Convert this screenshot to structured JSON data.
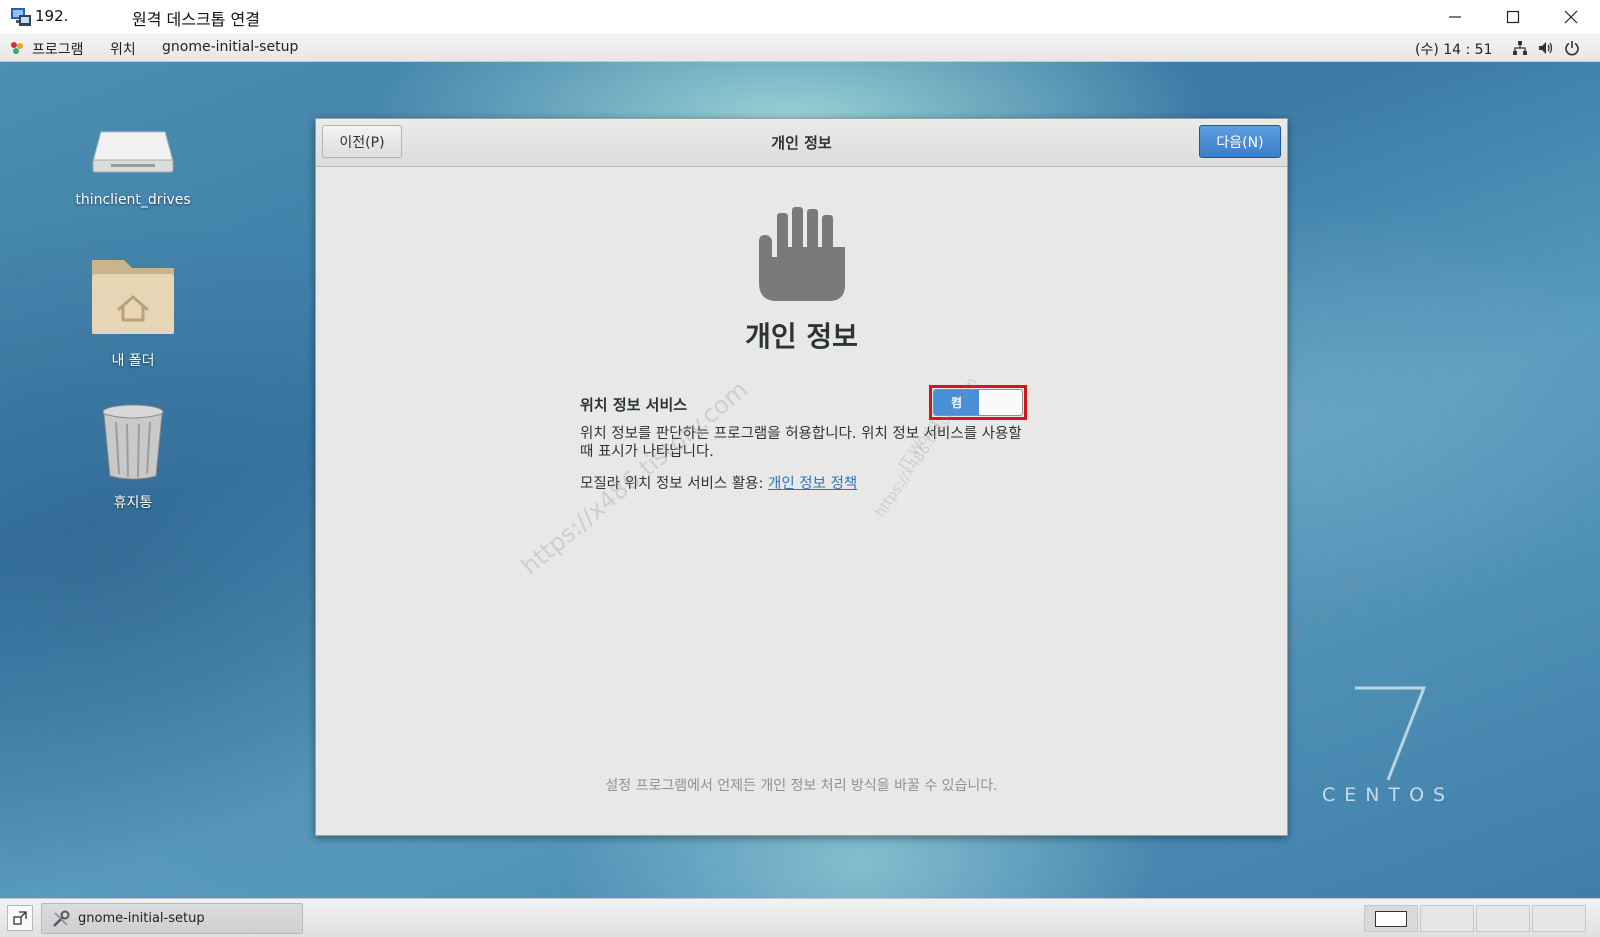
{
  "rdp_window": {
    "ip": "192.",
    "title": "원격 데스크톱 연결"
  },
  "top_panel": {
    "applications": "프로그램",
    "places": "위치",
    "active_app": "gnome-initial-setup",
    "clock": "(수) 14 : 51",
    "tray_icons": [
      "network-icon",
      "volume-icon",
      "power-icon"
    ]
  },
  "desktop": {
    "icons": [
      {
        "label": "thinclient_drives",
        "icon": "drive-icon"
      },
      {
        "label": "내 폴더",
        "icon": "home-folder-icon"
      },
      {
        "label": "휴지통",
        "icon": "trash-icon"
      }
    ],
    "centos_brand": "CENTOS"
  },
  "dialog": {
    "title": "개인 정보",
    "prev_button": "이전(P)",
    "next_button": "다음(N)",
    "heading": "개인 정보",
    "location_label": "위치 정보 서비스",
    "toggle_state": "켬",
    "location_description": "위치 정보를 판단하는 프로그램을 허용합니다. 위치 정보 서비스를 사용할 때 표시가 나타납니다.",
    "mozilla_prefix": "모질라 위치 정보 서비스 활용: ",
    "privacy_link": "개인 정보 정책",
    "footer": "설정 프로그램에서 언제든 개인 정보 처리 방식을 바꿀 수 있습니다."
  },
  "watermark": {
    "brand": "IT World",
    "url": "https://x486.tistory.com"
  },
  "taskbar": {
    "task_label": "gnome-initial-setup",
    "workspaces": 4
  },
  "colors": {
    "accent_blue": "#4a90d9",
    "highlight_red": "#d3151f",
    "link_blue": "#2a76c6"
  }
}
